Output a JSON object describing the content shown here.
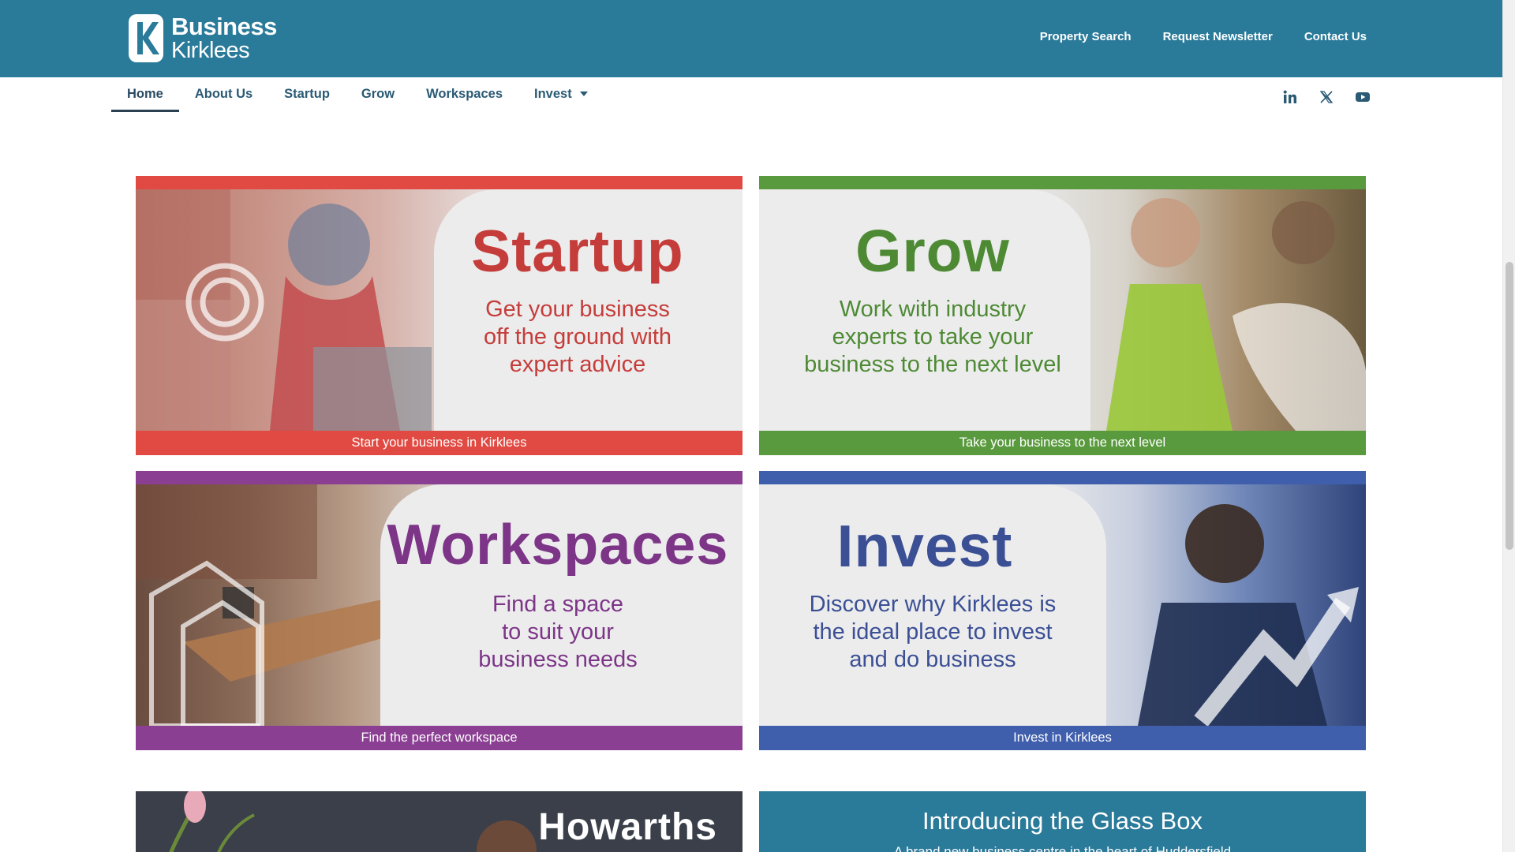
{
  "header": {
    "logo_line1": "Business",
    "logo_line2": "Kirklees",
    "utility_links": [
      "Property Search",
      "Request Newsletter",
      "Contact Us"
    ]
  },
  "nav": {
    "items": [
      "Home",
      "About Us",
      "Startup",
      "Grow",
      "Workspaces",
      "Invest"
    ],
    "active": "Home"
  },
  "social": [
    "linkedin-icon",
    "x-icon",
    "youtube-icon"
  ],
  "cards": [
    {
      "key": "startup",
      "heading": "Startup",
      "subtitle": [
        "Get your business",
        "off the ground with",
        "expert advice"
      ],
      "button": "Start your business in Kirklees",
      "accent": "#e04a42",
      "heading_color": "#c53d3a"
    },
    {
      "key": "grow",
      "heading": "Grow",
      "subtitle": [
        "Work with industry",
        "experts to take your",
        "business to the next level"
      ],
      "button": "Take your business to the next level",
      "accent": "#5a9a3e",
      "heading_color": "#4e8a34"
    },
    {
      "key": "workspaces",
      "heading": "Workspaces",
      "subtitle": [
        "Find a space",
        "to suit your",
        "business needs"
      ],
      "button": "Find the perfect workspace",
      "accent": "#8a3f92",
      "heading_color": "#7d3587"
    },
    {
      "key": "invest",
      "heading": "Invest",
      "subtitle": [
        "Discover why Kirklees is",
        "the ideal place to invest",
        "and do business"
      ],
      "button": "Invest in Kirklees",
      "accent": "#3f5fad",
      "heading_color": "#3b4f94"
    }
  ],
  "promos": {
    "howarths": "Howarths",
    "glassbox_title": "Introducing the Glass Box",
    "glassbox_subtitle": "A brand new business centre in the heart of Huddersfield"
  }
}
